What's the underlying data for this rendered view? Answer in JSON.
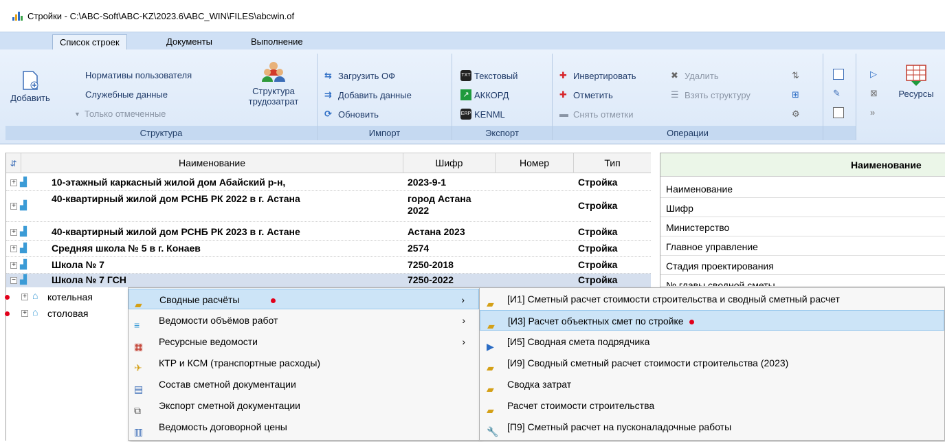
{
  "window": {
    "title": "Стройки - C:\\ABC-Soft\\ABC-KZ\\2023.6\\ABC_WIN\\FILES\\abcwin.of"
  },
  "tabs": [
    "Список строек",
    "Документы",
    "Выполнение"
  ],
  "ribbon": {
    "structure": {
      "add_label": "Добавить",
      "items": [
        "Нормативы пользователя",
        "Служебные данные",
        "Только отмеченные"
      ],
      "labor_label_1": "Структура",
      "labor_label_2": "трудозатрат",
      "group_label": "Структура"
    },
    "import": {
      "items": [
        "Загрузить ОФ",
        "Добавить данные",
        "Обновить"
      ],
      "group_label": "Импорт"
    },
    "export": {
      "items": [
        "Текстовый",
        "АККОРД",
        "KENML"
      ],
      "group_label": "Экспорт"
    },
    "operations": {
      "items": [
        "Инвертировать",
        "Отметить",
        "Снять отметки",
        "Удалить",
        "Взять структуру"
      ],
      "group_label": "Операции"
    },
    "resources_label": "Ресурсы"
  },
  "grid": {
    "columns": [
      "Наименование",
      "Шифр",
      "Номер",
      "Тип"
    ],
    "rows": [
      {
        "name": "10-этажный каркасный жилой дом Абайский р-н,",
        "code": "2023-9-1",
        "type": "Стройка"
      },
      {
        "name": "40-квартирный жилой дом РСНБ РК 2022 в г. Астана",
        "code_1": "город Астана",
        "code_2": "2022",
        "type": "Стройка"
      },
      {
        "name": "40-квартирный жилой дом РСНБ РК 2023 в г. Астане",
        "code": "Астана 2023",
        "type": "Стройка"
      },
      {
        "name": "Средняя школа № 5 в г. Конаев",
        "code": "2574",
        "type": "Стройка"
      },
      {
        "name": "Школа № 7",
        "code": "7250-2018",
        "type": "Стройка"
      },
      {
        "name": "Школа № 7 ГСН",
        "code": "7250-2022",
        "type": "Стройка"
      }
    ],
    "subrows": [
      "котельная",
      "столовая"
    ]
  },
  "right_panel": {
    "header": "Наименование",
    "rows": [
      "Наименование",
      "Шифр",
      "Министерство",
      "Главное управление",
      "Стадия проектирования",
      "№ главы сводной сметы"
    ]
  },
  "context_menu": {
    "items": [
      "Сводные расчёты",
      "Ведомости объёмов работ",
      "Ресурсные ведомости",
      "КТР и КСМ (транспортные расходы)",
      "Состав сметной документации",
      "Экспорт сметной документации",
      "Ведомость договорной цены"
    ]
  },
  "submenu": {
    "items": [
      "[И1] Сметный расчет стоимости строительства и сводный сметный расчет",
      "[И3] Расчет объектных смет по стройке",
      "[И5] Сводная смета подрядчика",
      "[И9] Сводный сметный расчет стоимости строительства (2023)",
      "Сводка затрат",
      "Расчет стоимости строительства",
      "[П9] Сметный расчет на пусконаладочные работы"
    ]
  },
  "colors": {
    "accent": "#cce4f7",
    "ribbon": "#dbe8f8",
    "marker": "#e2001a"
  }
}
